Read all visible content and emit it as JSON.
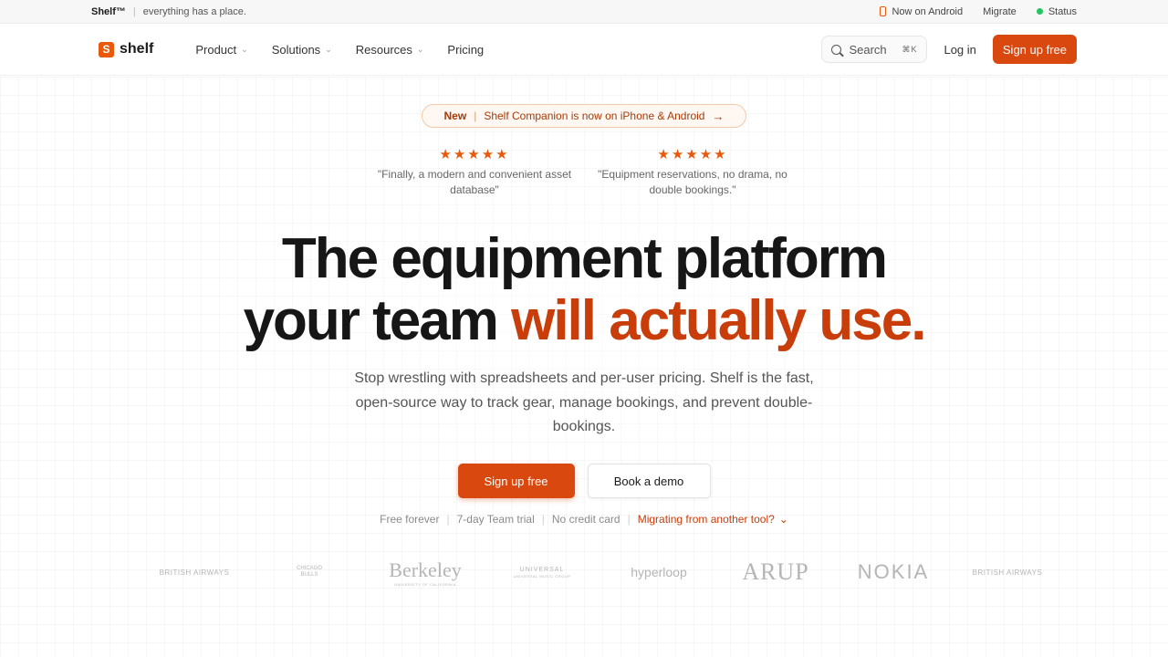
{
  "topbar": {
    "brand": "Shelf™",
    "tagline": "everything has a place.",
    "android": "Now on Android",
    "migrate": "Migrate",
    "status": "Status"
  },
  "nav": {
    "logo": "shelf",
    "menu": [
      "Product",
      "Solutions",
      "Resources",
      "Pricing"
    ],
    "search_label": "Search",
    "search_shortcut": "⌘K",
    "login": "Log in",
    "signup": "Sign up free"
  },
  "announcement": {
    "badge": "New",
    "text": "Shelf Companion is now on iPhone & Android",
    "arrow": "→"
  },
  "reviews": [
    {
      "stars": "★★★★★",
      "quote": "\"Finally, a modern and convenient asset database\""
    },
    {
      "stars": "★★★★★",
      "quote": "\"Equipment reservations, no drama, no double bookings.\""
    }
  ],
  "hero": {
    "line1": "The equipment platform",
    "line2_plain": "your team ",
    "line2_accent": "will actually use.",
    "subtitle": "Stop wrestling with spreadsheets and per-user pricing. Shelf is the fast, open-source way to track gear, manage bookings, and prevent double-bookings.",
    "cta_primary": "Sign up free",
    "cta_secondary": "Book a demo"
  },
  "perks": {
    "items": [
      "Free forever",
      "7-day Team trial",
      "No credit card"
    ],
    "migrate_link": "Migrating from another tool?"
  },
  "logos": {
    "british_airways": "BRITISH AIRWAYS",
    "bulls": "CHICAGO BULLS",
    "berkeley": "Berkeley",
    "berkeley_sub": "UNIVERSITY OF CALIFORNIA",
    "universal": "UNIVERSAL",
    "universal_sub": "UNIVERSAL MUSIC GROUP",
    "hyperloop": "hyperloop",
    "arup": "ARUP",
    "nokia": "NOKIA"
  },
  "colors": {
    "accent": "#d9480f",
    "accent_text": "#c93d0b",
    "status_green": "#22c55e"
  }
}
